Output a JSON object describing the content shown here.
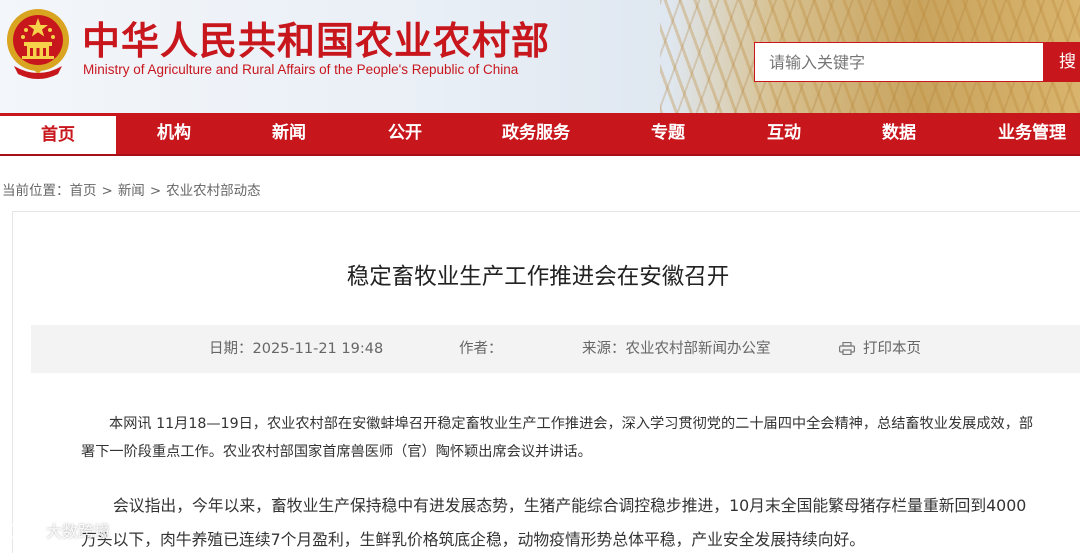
{
  "header": {
    "title": "中华人民共和国农业农村部",
    "subtitle": "Ministry of Agriculture and Rural Affairs of the People's Republic of China",
    "search_placeholder": "请输入关键字",
    "search_button": "搜"
  },
  "nav": {
    "items": [
      "首页",
      "机构",
      "新闻",
      "公开",
      "政务服务",
      "专题",
      "互动",
      "数据",
      "业务管理"
    ]
  },
  "breadcrumb": {
    "prefix": "当前位置：",
    "items": [
      "首页",
      "新闻",
      "农业农村部动态"
    ],
    "separator": ">"
  },
  "article": {
    "title": "稳定畜牧业生产工作推进会在安徽召开",
    "date_label": "日期：",
    "date_value": "2025-11-21 19:48",
    "author_label": "作者：",
    "source_label": "来源：",
    "source_value": "农业农村部新闻办公室",
    "print_label": "打印本页",
    "paragraphs": [
      "本网讯   11月18—19日，农业农村部在安徽蚌埠召开稳定畜牧业生产工作推进会，深入学习贯彻党的二十届四中全会精神，总结畜牧业发展成效，部署下一阶段重点工作。农业农村部国家首席兽医师（官）陶怀颖出席会议并讲话。",
      "会议指出，今年以来，畜牧业生产保持稳中有进发展态势，生猪产能综合调控稳步推进，10月末全国能繁母猪存栏量重新回到4000万头以下，肉牛养殖已连续7个月盈利，生鲜乳价格筑底企稳，动物疫情形势总体平稳，产业安全发展持续向好。"
    ]
  },
  "watermark": {
    "text": "大数跨境"
  },
  "colors": {
    "brand_red": "#c8161d",
    "meta_bg": "#f3f3f3"
  },
  "icons": {
    "emblem": "national-emblem-icon",
    "print": "printer-icon"
  }
}
